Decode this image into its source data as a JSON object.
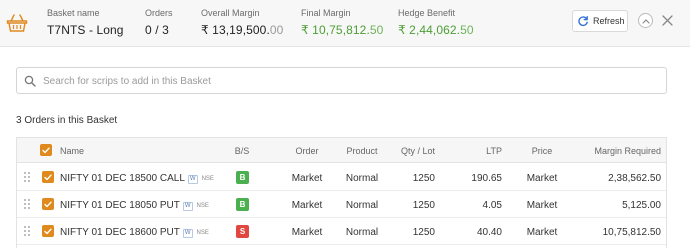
{
  "header": {
    "basket_name_label": "Basket name",
    "basket_name": "T7NTS - Long",
    "orders_label": "Orders",
    "orders_value": "0 / 3",
    "overall_margin_label": "Overall Margin",
    "overall_margin_main": "₹ 13,19,500.",
    "overall_margin_paise": "00",
    "final_margin_label": "Final Margin",
    "final_margin_main": "₹ 10,75,812.",
    "final_margin_paise": "50",
    "hedge_benefit_label": "Hedge Benefit",
    "hedge_benefit_main": "₹ 2,44,062.",
    "hedge_benefit_paise": "50",
    "refresh_label": "Refresh"
  },
  "search": {
    "placeholder": "Search for scrips to add in this Basket",
    "value": ""
  },
  "orders_title": "3 Orders in this Basket",
  "table": {
    "columns": {
      "name": "Name",
      "bs": "B/S",
      "order": "Order",
      "product": "Product",
      "qty": "Qty / Lot",
      "ltp": "LTP",
      "price": "Price",
      "margin": "Margin Required"
    },
    "rows": [
      {
        "name": "NIFTY 01 DEC 18500 CALL",
        "tag": "W",
        "exchange": "NSE",
        "bs": "B",
        "order": "Market",
        "product": "Normal",
        "qty": "1250",
        "ltp": "190.65",
        "price": "Market",
        "margin": "2,38,562.50"
      },
      {
        "name": "NIFTY 01 DEC 18050 PUT",
        "tag": "W",
        "exchange": "NSE",
        "bs": "B",
        "order": "Market",
        "product": "Normal",
        "qty": "1250",
        "ltp": "4.05",
        "price": "Market",
        "margin": "5,125.00"
      },
      {
        "name": "NIFTY 01 DEC 18600 PUT",
        "tag": "W",
        "exchange": "NSE",
        "bs": "S",
        "order": "Market",
        "product": "Normal",
        "qty": "1250",
        "ltp": "40.40",
        "price": "Market",
        "margin": "10,75,812.50"
      }
    ]
  },
  "colors": {
    "accent": "#e08a1e",
    "green": "#4c9e34",
    "buy": "#4caf50",
    "sell": "#e2473f",
    "refresh_icon": "#2f6fd6"
  },
  "icons": {
    "basket": "basket-icon",
    "refresh": "refresh-icon",
    "collapse": "chevron-up-icon",
    "close": "close-icon",
    "search": "search-icon",
    "check": "checkmark-icon",
    "drag": "drag-handle-icon"
  }
}
